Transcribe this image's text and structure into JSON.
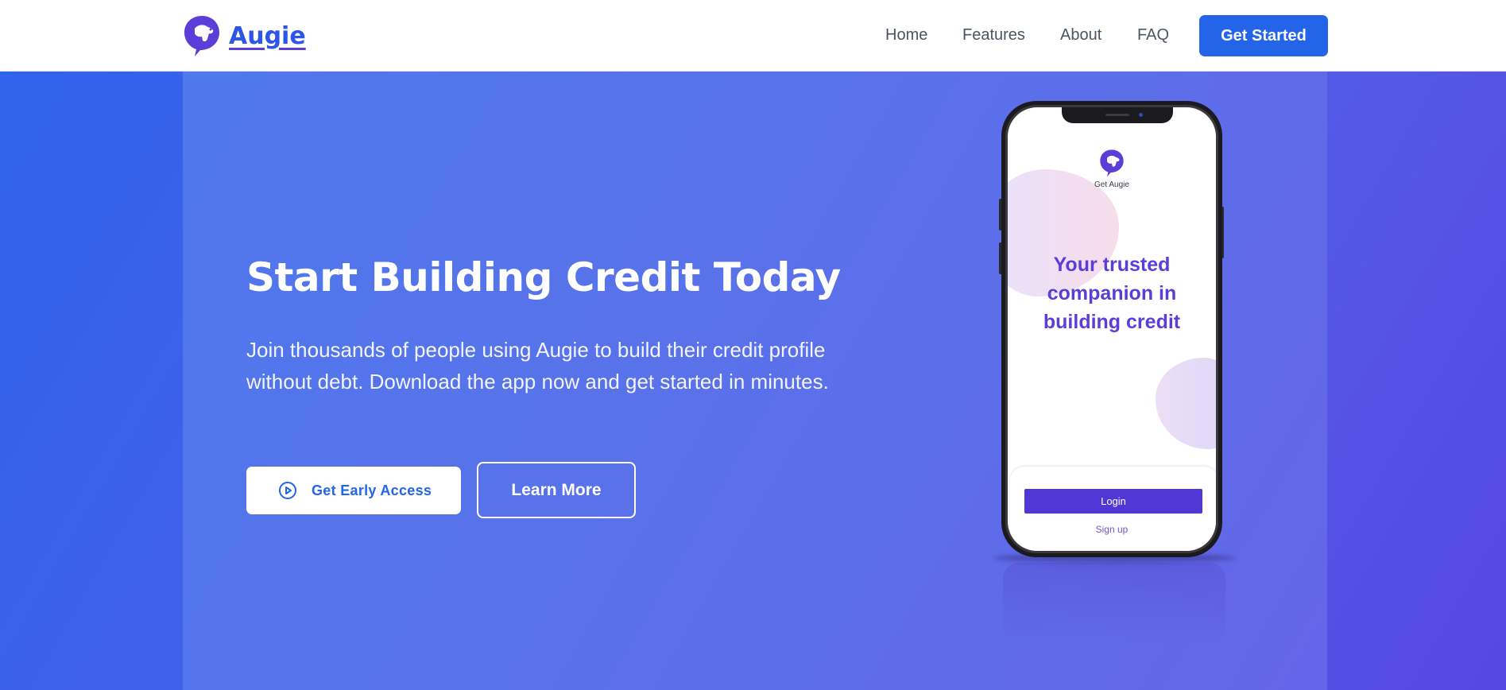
{
  "header": {
    "brand": "Augie",
    "nav": [
      {
        "label": "Home"
      },
      {
        "label": "Features"
      },
      {
        "label": "About"
      },
      {
        "label": "FAQ"
      }
    ],
    "cta_label": "Get Started"
  },
  "hero": {
    "title": "Start Building Credit Today",
    "subtitle": "Join thousands of people using Augie to build their credit profile without debt. Download the app now and get started in minutes.",
    "primary_button": "Get Early Access",
    "secondary_button": "Learn More"
  },
  "phone": {
    "brand": "Get Augie",
    "tagline": "Your trusted companion in building credit",
    "login_button": "Login",
    "signup_link": "Sign up"
  },
  "icons": {
    "logo": "dog-head-logo-icon",
    "play": "play-circle-icon"
  },
  "colors": {
    "brand_blue": "#2364e8",
    "brand_purple": "#5b3ed8",
    "hero_gradient_start": "#4f79ec",
    "hero_gradient_end": "#6467e8"
  }
}
